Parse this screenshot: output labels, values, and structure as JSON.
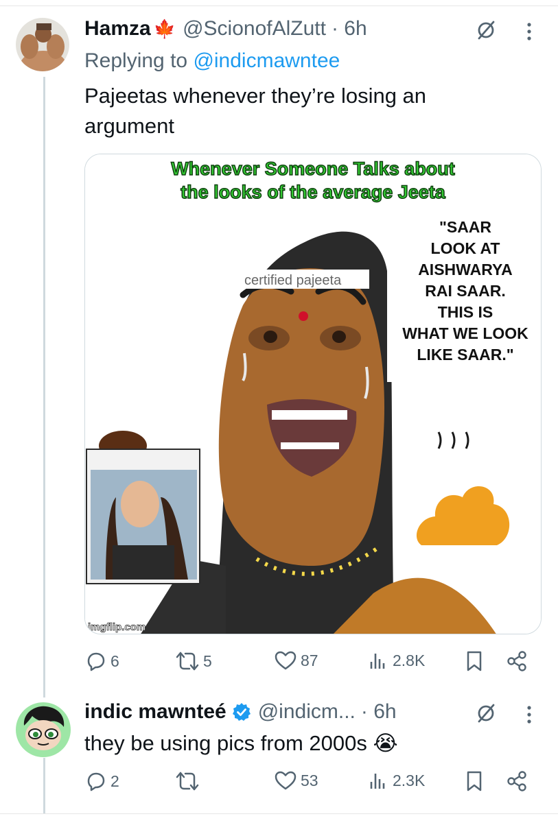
{
  "tweet1": {
    "name": "Hamza",
    "flag": "🍁",
    "handle": "@ScionofAlZutt",
    "time": "· 6h",
    "replying_prefix": "Replying to",
    "replying_handle": "@indicmawntee",
    "text": "Pajeetas whenever they’re losing an argument",
    "media": {
      "caption_line1": "Whenever Someone Talks about",
      "caption_line2": "the looks of the average Jeeta",
      "label": "certified pajeeta",
      "quote_lines": [
        "\"SAAR",
        "LOOK AT",
        "AISHWARYA",
        "RAI SAAR.",
        "THIS IS",
        "WHAT WE LOOK",
        "LIKE SAAR.\""
      ],
      "watermark": "imgflip.com"
    },
    "stats": {
      "replies": "6",
      "reposts": "5",
      "likes": "87",
      "views": "2.8K"
    }
  },
  "tweet2": {
    "name": "indic mawnteé",
    "handle": "@indicm...",
    "time": "· 6h",
    "text": "they be using pics from 2000s",
    "emoji": "😭",
    "stats": {
      "replies": "2",
      "reposts": "",
      "likes": "53",
      "views": "2.3K"
    }
  },
  "colors": {
    "accent": "#1d9bf0",
    "muted": "#536471",
    "text": "#0f1419",
    "caption_green": "#33cc33"
  },
  "icons": [
    "reply-icon",
    "repost-icon",
    "like-icon",
    "views-icon",
    "bookmark-icon",
    "share-icon",
    "grok-icon",
    "more-icon",
    "verified-icon"
  ]
}
